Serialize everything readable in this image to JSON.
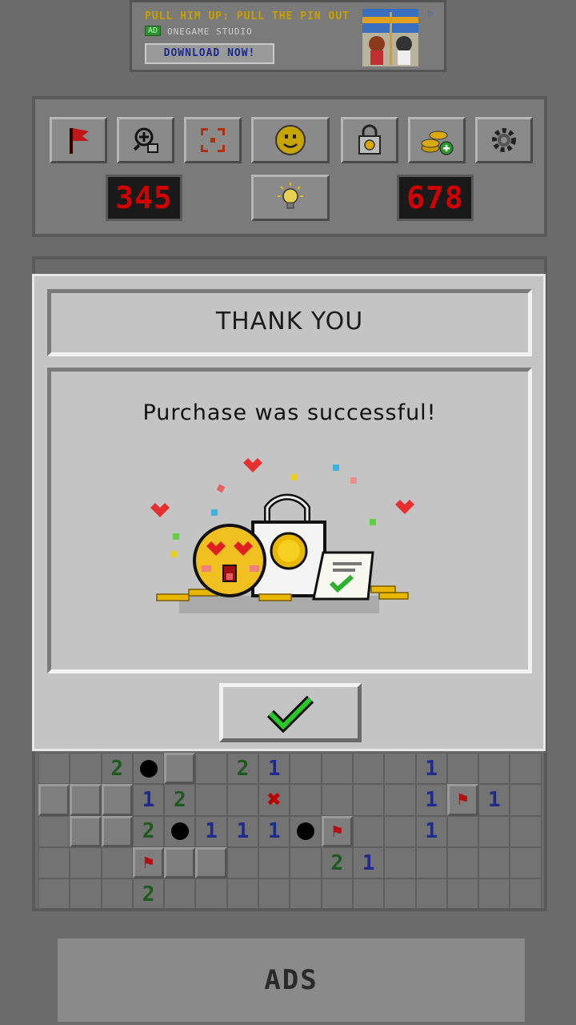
{
  "top_ad": {
    "headline": "PULL HIM UP: PULL THE PIN OUT",
    "ad_tag": "AD",
    "studio": "ONEGAME STUDIO",
    "cta": "DOWNLOAD NOW!"
  },
  "toolbar": {
    "icons": [
      "flag-icon",
      "zoom-in-icon",
      "fit-screen-icon",
      "smiley-icon",
      "shop-lock-icon",
      "coins-add-icon",
      "gear-icon"
    ],
    "mine_counter": "345",
    "timer": "678"
  },
  "dialog": {
    "title": "THANK YOU",
    "message": "Purchase was successful!",
    "ok_icon": "checkmark-icon"
  },
  "board": {
    "visible_rows": [
      [
        "_",
        "_",
        "2",
        "M",
        "C",
        "_",
        "2",
        "1",
        "_",
        "_",
        "_",
        "_",
        "1",
        "_",
        "_",
        "_"
      ],
      [
        "C",
        "C",
        "C",
        "1",
        "2",
        "_",
        "_",
        "X",
        "_",
        "_",
        "_",
        "_",
        "1",
        "F",
        "1",
        "_"
      ],
      [
        "_",
        "C",
        "C",
        "2",
        "M",
        "1",
        "1",
        "1",
        "M",
        "F",
        "_",
        "_",
        "1",
        "_",
        "_",
        "_"
      ],
      [
        "_",
        "_",
        "_",
        "F",
        "C",
        "C",
        "_",
        "_",
        "_",
        "2",
        "1",
        "_",
        "_",
        "_",
        "_",
        "_"
      ],
      [
        "_",
        "_",
        "_",
        "2",
        "_",
        "_",
        "_",
        "_",
        "_",
        "_",
        "_",
        "_",
        "_",
        "_",
        "_",
        "_"
      ]
    ]
  },
  "bottom_ads": {
    "label": "ADS"
  }
}
